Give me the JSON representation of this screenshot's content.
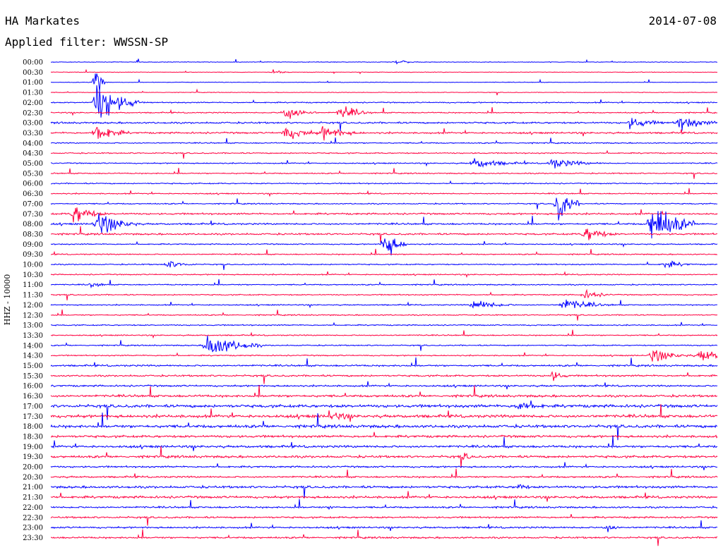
{
  "header": {
    "station": "HA Markates",
    "date": "2014-07-08",
    "filter": "Applied filter: WWSSN-SP"
  },
  "chart_data": {
    "type": "line",
    "chart_kind": "helicorder seismogram",
    "title": "HA Markates",
    "date": "2014-07-08",
    "filter": "WWSSN-SP",
    "ylabel": "HHZ - 10000",
    "colors": {
      "trace_a": "#0000ff",
      "trace_b": "#ff0040"
    },
    "color_order": "alternating blue / red per trace",
    "grid": false,
    "legend": "none",
    "row_times": [
      "00:00",
      "00:30",
      "01:00",
      "01:30",
      "02:00",
      "02:30",
      "03:00",
      "03:30",
      "04:00",
      "04:30",
      "05:00",
      "05:30",
      "06:00",
      "06:30",
      "07:00",
      "07:30",
      "08:00",
      "08:30",
      "09:00",
      "09:30",
      "10:00",
      "10:30",
      "11:00",
      "11:30",
      "12:00",
      "12:30",
      "13:00",
      "13:30",
      "14:00",
      "14:30",
      "15:00",
      "15:30",
      "16:00",
      "16:30",
      "17:00",
      "17:30",
      "18:00",
      "18:30",
      "19:00",
      "19:30",
      "20:00",
      "20:30",
      "21:00",
      "21:30",
      "22:00",
      "22:30",
      "23:00",
      "23:30"
    ],
    "row_noise_level": [
      1,
      1,
      1,
      1,
      2,
      2,
      3,
      3,
      2,
      2,
      2,
      2,
      2,
      2,
      2,
      3,
      3,
      3,
      2,
      2,
      2,
      2,
      2,
      2,
      2,
      2,
      2,
      2,
      2,
      2,
      3,
      3,
      3,
      4,
      5,
      5,
      5,
      4,
      4,
      4,
      3,
      3,
      4,
      4,
      3,
      3,
      3,
      3
    ],
    "events": [
      {
        "row": "00:00",
        "minute": 15.5,
        "amplitude": 6,
        "duration_min": 1
      },
      {
        "row": "00:30",
        "minute": 10.0,
        "amplitude": 5,
        "duration_min": 1
      },
      {
        "row": "01:00",
        "minute": 2.0,
        "amplitude": 40,
        "duration_min": 0.5
      },
      {
        "row": "02:00",
        "minute": 2.0,
        "amplitude": 50,
        "duration_min": 2
      },
      {
        "row": "02:30",
        "minute": 10.5,
        "amplitude": 20,
        "duration_min": 1.5
      },
      {
        "row": "02:30",
        "minute": 13.0,
        "amplitude": 18,
        "duration_min": 1.5
      },
      {
        "row": "03:00",
        "minute": 26.0,
        "amplitude": 14,
        "duration_min": 2
      },
      {
        "row": "03:00",
        "minute": 28.2,
        "amplitude": 18,
        "duration_min": 2
      },
      {
        "row": "03:30",
        "minute": 2.0,
        "amplitude": 26,
        "duration_min": 1.5
      },
      {
        "row": "03:30",
        "minute": 10.5,
        "amplitude": 16,
        "duration_min": 2
      },
      {
        "row": "03:30",
        "minute": 12.2,
        "amplitude": 16,
        "duration_min": 2
      },
      {
        "row": "05:00",
        "minute": 19.0,
        "amplitude": 12,
        "duration_min": 2.5
      },
      {
        "row": "05:00",
        "minute": 22.5,
        "amplitude": 12,
        "duration_min": 2.5
      },
      {
        "row": "07:00",
        "minute": 22.8,
        "amplitude": 45,
        "duration_min": 1
      },
      {
        "row": "07:30",
        "minute": 1.0,
        "amplitude": 25,
        "duration_min": 1.5
      },
      {
        "row": "08:00",
        "minute": 2.0,
        "amplitude": 30,
        "duration_min": 2
      },
      {
        "row": "08:00",
        "minute": 27.0,
        "amplitude": 55,
        "duration_min": 2
      },
      {
        "row": "08:30",
        "minute": 24.0,
        "amplitude": 20,
        "duration_min": 1.5
      },
      {
        "row": "09:00",
        "minute": 15.0,
        "amplitude": 40,
        "duration_min": 1
      },
      {
        "row": "10:00",
        "minute": 5.2,
        "amplitude": 10,
        "duration_min": 1.5
      },
      {
        "row": "10:00",
        "minute": 27.6,
        "amplitude": 10,
        "duration_min": 1.5
      },
      {
        "row": "11:00",
        "minute": 1.8,
        "amplitude": 8,
        "duration_min": 1
      },
      {
        "row": "11:30",
        "minute": 24.0,
        "amplitude": 10,
        "duration_min": 1.5
      },
      {
        "row": "12:00",
        "minute": 19.0,
        "amplitude": 13,
        "duration_min": 2
      },
      {
        "row": "12:00",
        "minute": 23.0,
        "amplitude": 14,
        "duration_min": 2.5
      },
      {
        "row": "14:00",
        "minute": 7.0,
        "amplitude": 30,
        "duration_min": 2.5
      },
      {
        "row": "14:30",
        "minute": 27.0,
        "amplitude": 16,
        "duration_min": 2
      },
      {
        "row": "14:30",
        "minute": 29.2,
        "amplitude": 16,
        "duration_min": 2
      },
      {
        "row": "15:30",
        "minute": 22.5,
        "amplitude": 14,
        "duration_min": 1
      },
      {
        "row": "17:00",
        "minute": 21.0,
        "amplitude": 14,
        "duration_min": 2
      },
      {
        "row": "17:30",
        "minute": 12.5,
        "amplitude": 12,
        "duration_min": 2
      },
      {
        "row": "19:30",
        "minute": 18.5,
        "amplitude": 10,
        "duration_min": 1
      },
      {
        "row": "21:00",
        "minute": 21.0,
        "amplitude": 10,
        "duration_min": 1
      },
      {
        "row": "22:00",
        "minute": 12.5,
        "amplitude": 5,
        "duration_min": 1
      },
      {
        "row": "23:00",
        "minute": 25.0,
        "amplitude": 12,
        "duration_min": 0.8
      }
    ]
  }
}
